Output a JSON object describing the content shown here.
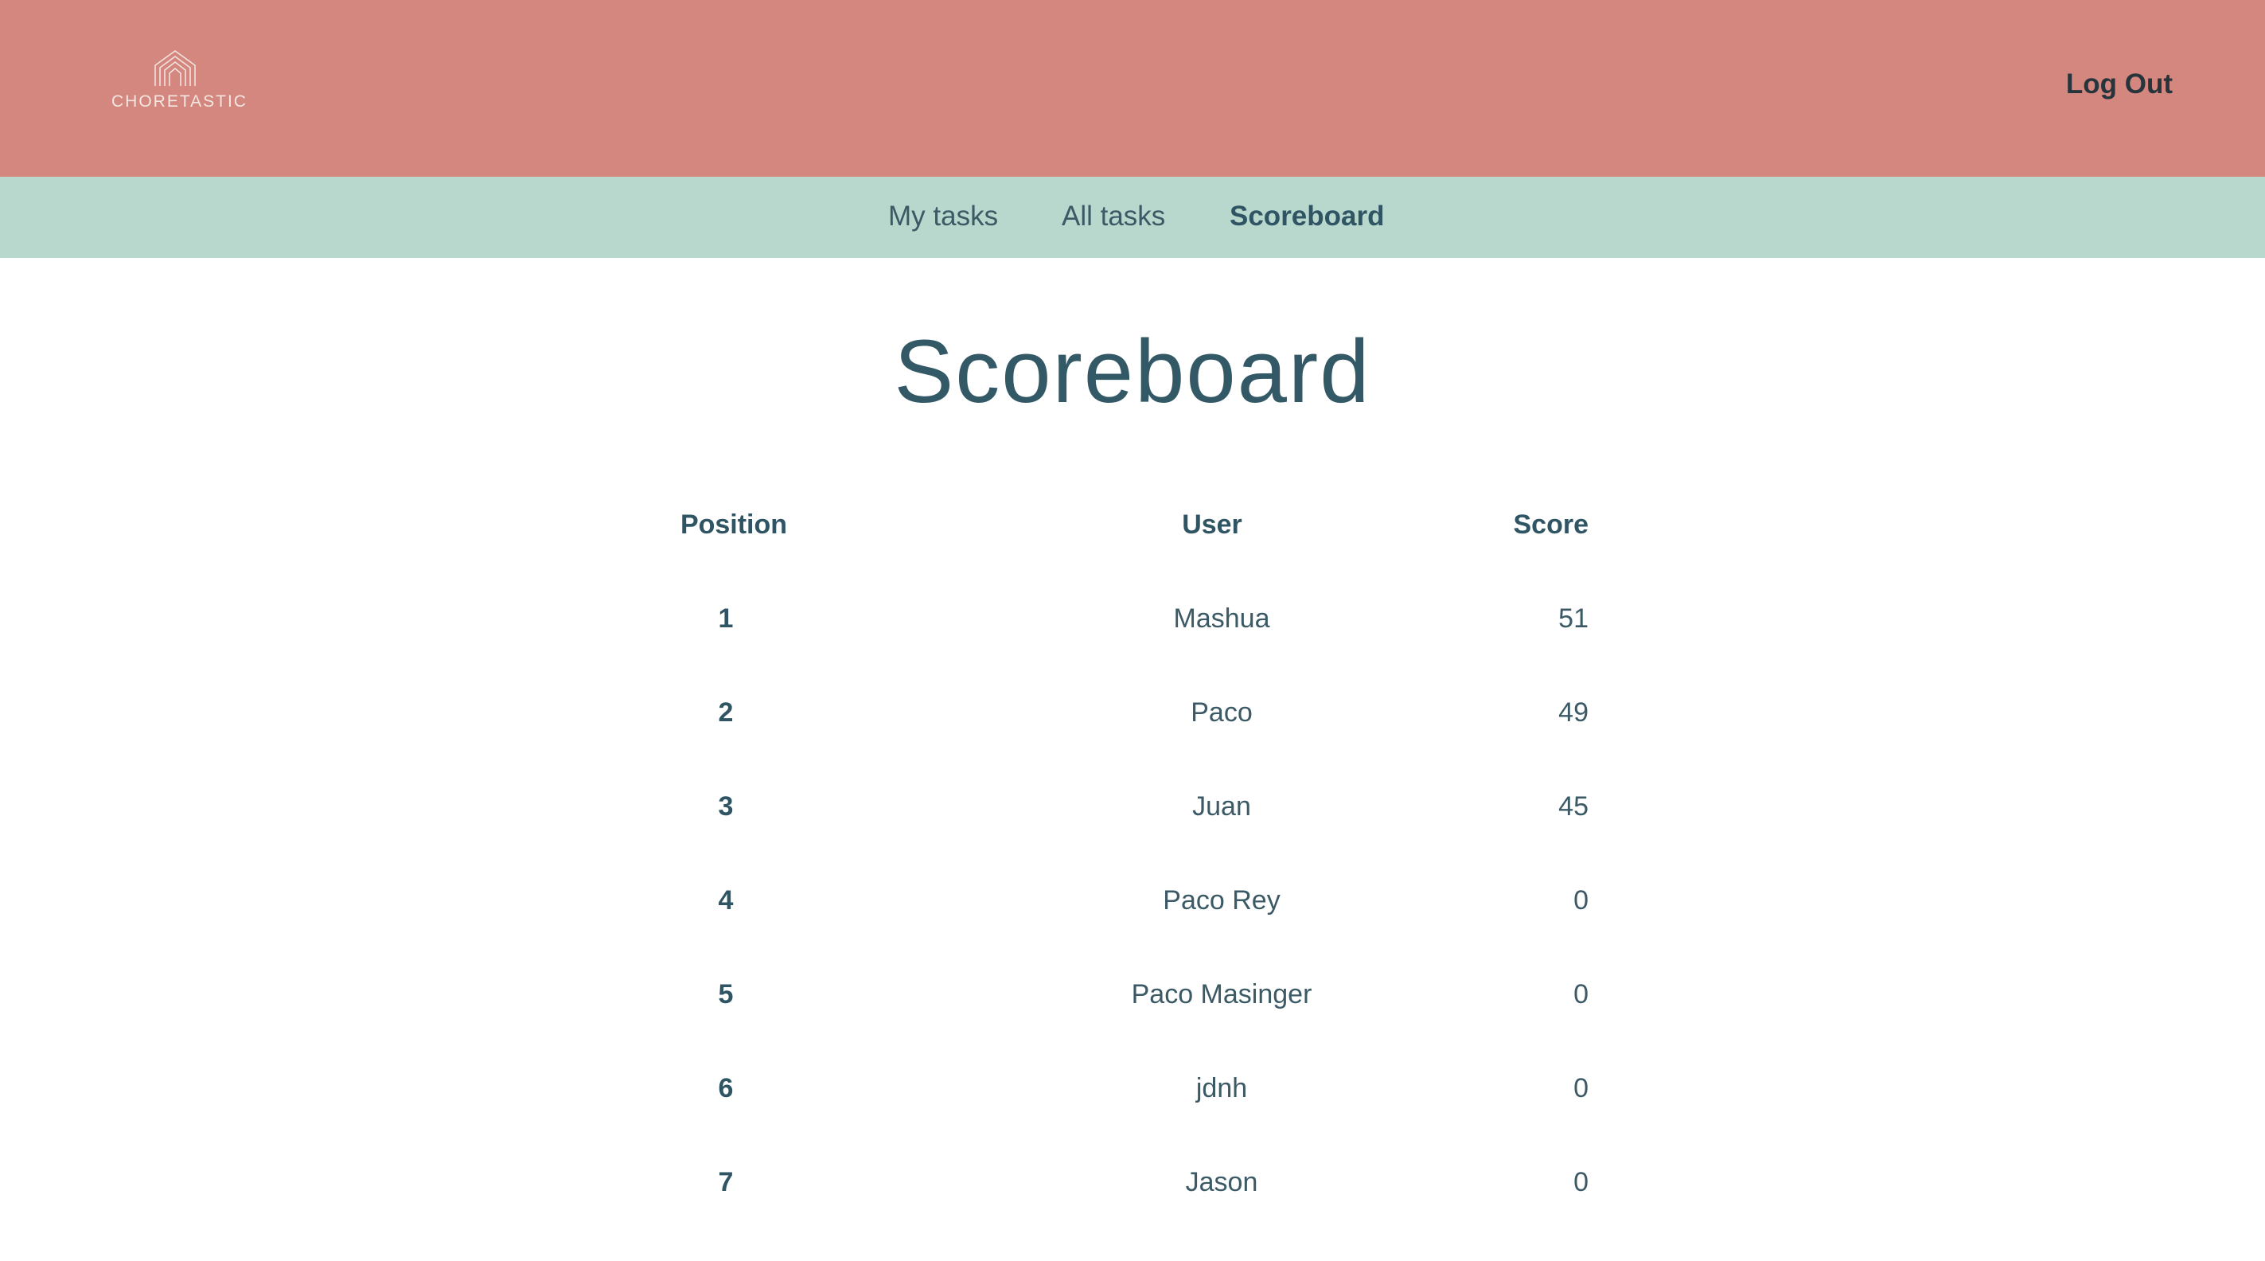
{
  "header": {
    "brand": "CHORETASTIC",
    "logout_label": "Log Out"
  },
  "nav": {
    "items": [
      {
        "label": "My tasks",
        "active": false
      },
      {
        "label": "All tasks",
        "active": false
      },
      {
        "label": "Scoreboard",
        "active": true
      }
    ]
  },
  "page": {
    "title": "Scoreboard"
  },
  "table": {
    "columns": [
      "Position",
      "User",
      "Score"
    ],
    "rows": [
      {
        "position": "1",
        "user": "Mashua",
        "score": "51"
      },
      {
        "position": "2",
        "user": "Paco",
        "score": "49"
      },
      {
        "position": "3",
        "user": "Juan",
        "score": "45"
      },
      {
        "position": "4",
        "user": "Paco Rey",
        "score": "0"
      },
      {
        "position": "5",
        "user": "Paco Masinger",
        "score": "0"
      },
      {
        "position": "6",
        "user": "jdnh",
        "score": "0"
      },
      {
        "position": "7",
        "user": "Jason",
        "score": "0"
      }
    ]
  },
  "colors": {
    "header_bg": "#d3877e",
    "nav_bg": "#b8d8ce",
    "text_primary": "#335866"
  },
  "icons": {
    "logo": "house-lines-logo-icon"
  }
}
